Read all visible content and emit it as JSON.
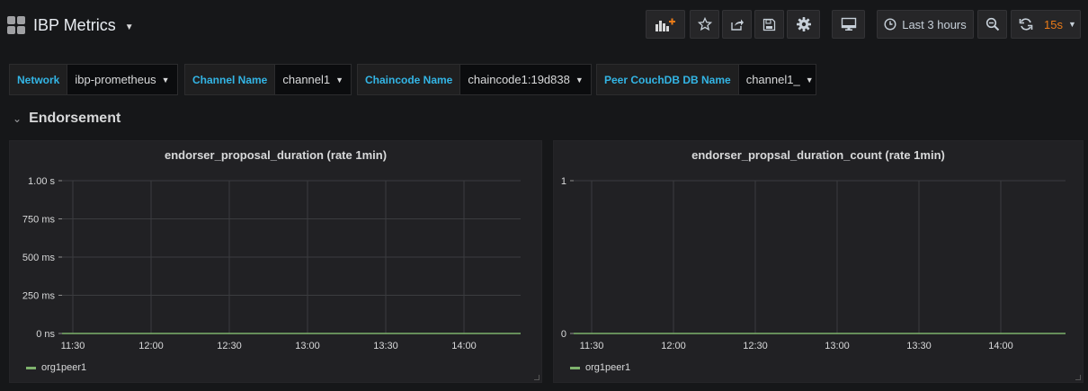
{
  "dashboard": {
    "title": "IBP Metrics"
  },
  "toolbar": {
    "time_range": "Last 3 hours",
    "refresh_rate": "15s"
  },
  "variables": [
    {
      "label": "Network",
      "value": "ibp-prometheus"
    },
    {
      "label": "Channel Name",
      "value": "channel1"
    },
    {
      "label": "Chaincode Name",
      "value": "chaincode1:19d838"
    },
    {
      "label": "Peer CouchDB DB Name",
      "value": "channel1_"
    }
  ],
  "row": {
    "title": "Endorsement"
  },
  "colors": {
    "series": "#7eb26d",
    "accent": "#33b5e5",
    "refresh": "#eb7b18"
  },
  "chart_data": [
    {
      "type": "line",
      "title": "endorser_proposal_duration (rate 1min)",
      "x": [
        "11:30",
        "12:00",
        "12:30",
        "13:00",
        "13:30",
        "14:00"
      ],
      "y_ticks": [
        "0 ns",
        "250 ms",
        "500 ms",
        "750 ms",
        "1.00 s"
      ],
      "ylim": [
        0,
        1
      ],
      "grid": true,
      "legend": "bottom-left",
      "series": [
        {
          "name": "org1peer1",
          "values": [
            0,
            0,
            0,
            0,
            0,
            0
          ]
        }
      ]
    },
    {
      "type": "line",
      "title": "endorser_propsal_duration_count (rate 1min)",
      "x": [
        "11:30",
        "12:00",
        "12:30",
        "13:00",
        "13:30",
        "14:00"
      ],
      "y_ticks": [
        "0",
        "1"
      ],
      "ylim": [
        0,
        1
      ],
      "grid": true,
      "legend": "bottom-left",
      "series": [
        {
          "name": "org1peer1",
          "values": [
            0,
            0,
            0,
            0,
            0,
            0
          ]
        }
      ]
    }
  ]
}
